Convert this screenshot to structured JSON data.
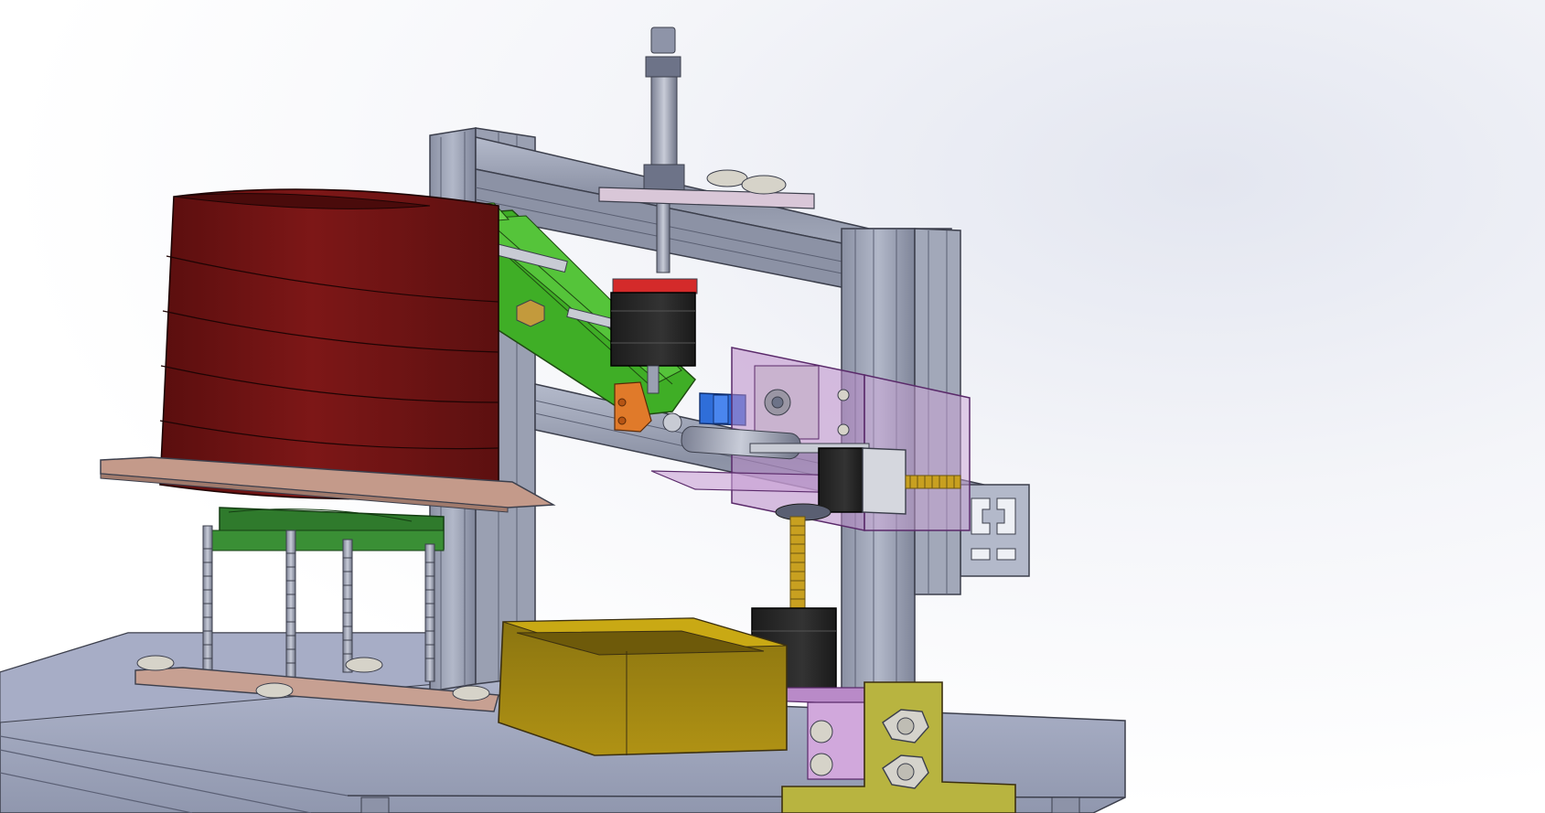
{
  "viewport": {
    "view_type": "cad-3d-model",
    "background_color": "#f2f3f8"
  },
  "model": {
    "parts": [
      {
        "name": "base-table",
        "color": "#a9afc8"
      },
      {
        "name": "aluminum-extrusion-frame",
        "color": "#9aa1b3"
      },
      {
        "name": "cylindrical-hopper",
        "color": "#6e1414"
      },
      {
        "name": "hopper-plate",
        "color": "#c49a8a"
      },
      {
        "name": "green-fan-housing",
        "color": "#2f7a2c"
      },
      {
        "name": "threaded-support-rods",
        "color": "#c9ccd6"
      },
      {
        "name": "green-arm-linkage",
        "color": "#3fae26"
      },
      {
        "name": "stepper-motor-top",
        "color": "#2a2a2a"
      },
      {
        "name": "stepper-motor-middle",
        "color": "#2a2a2a"
      },
      {
        "name": "stepper-motor-bottom",
        "color": "#2a2a2a"
      },
      {
        "name": "motor-cap-red",
        "color": "#d42a2a"
      },
      {
        "name": "pneumatic-cylinder",
        "color": "#8e94a8"
      },
      {
        "name": "purple-mounting-plates",
        "color": "#b98ac8"
      },
      {
        "name": "blue-coupler",
        "color": "#2f6ed9"
      },
      {
        "name": "orange-bracket",
        "color": "#e07a2a"
      },
      {
        "name": "yellow-tray",
        "color": "#c9a914"
      },
      {
        "name": "olive-bracket",
        "color": "#b8b440"
      },
      {
        "name": "lead-screw-springs",
        "color": "#c8a020"
      },
      {
        "name": "bolts-and-nuts",
        "color": "#d5d3cc"
      }
    ]
  }
}
